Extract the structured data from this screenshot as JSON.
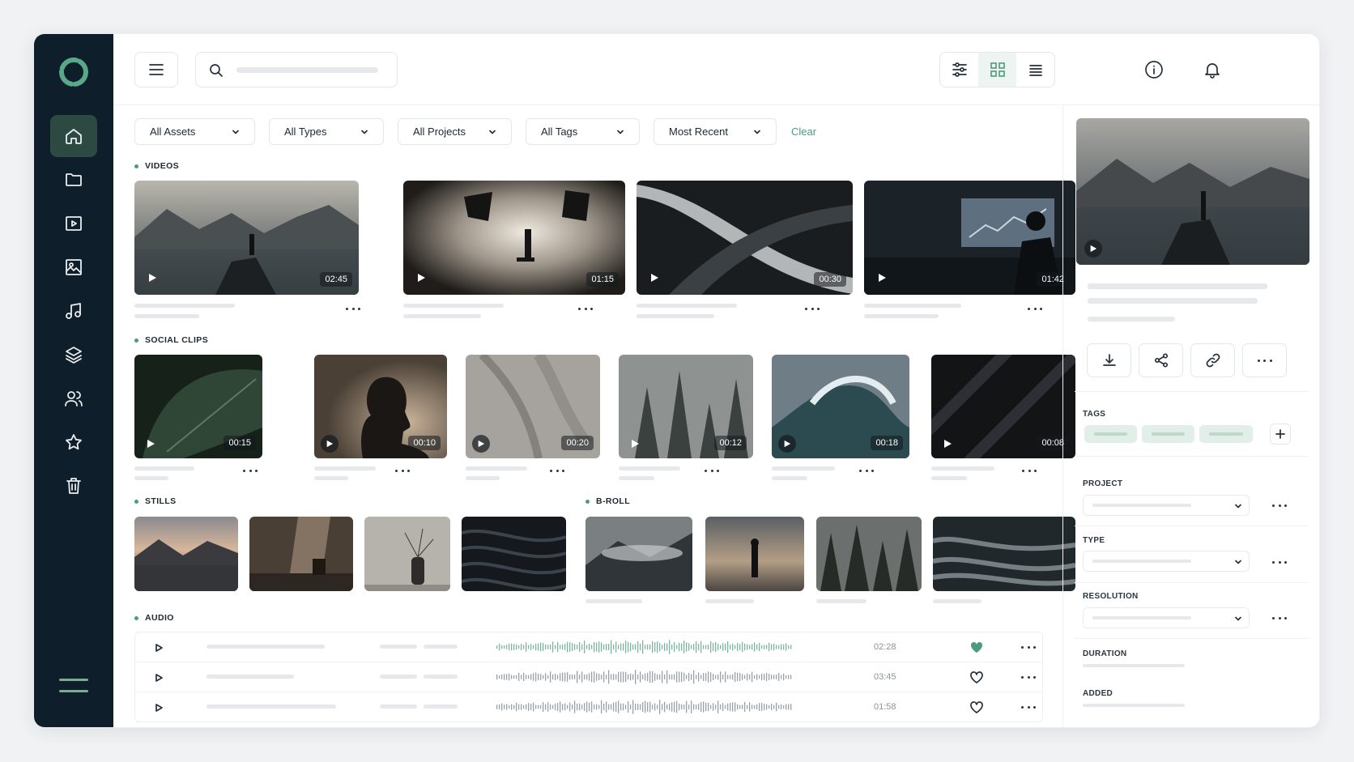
{
  "colors": {
    "sidebar": "#0f1e2b",
    "accent": "#4e9a7e",
    "active_nav": "#2c4a42"
  },
  "sidebar": {
    "items": [
      {
        "icon": "home-icon",
        "active": true
      },
      {
        "icon": "folder-icon"
      },
      {
        "icon": "video-icon"
      },
      {
        "icon": "image-icon"
      },
      {
        "icon": "music-icon"
      },
      {
        "icon": "layers-icon"
      },
      {
        "icon": "users-icon"
      },
      {
        "icon": "star-icon"
      },
      {
        "icon": "trash-icon"
      }
    ]
  },
  "topbar": {
    "view_modes": [
      "filter-settings-icon",
      "grid-icon",
      "list-icon"
    ],
    "active_view": "grid"
  },
  "filters": {
    "assets": "All Assets",
    "types": "All Types",
    "projects": "All Projects",
    "tags": "All Tags",
    "sort": "Most Recent",
    "clear": "Clear"
  },
  "sections": {
    "videos": "VIDEOS",
    "social": "SOCIAL CLIPS",
    "stills": "STILLS",
    "broll": "B-ROLL",
    "audio": "AUDIO"
  },
  "videos": [
    {
      "duration": "02:45"
    },
    {
      "duration": "01:15"
    },
    {
      "duration": "00:30"
    },
    {
      "duration": "01:42"
    }
  ],
  "social": [
    {
      "duration": "00:15"
    },
    {
      "duration": "00:10"
    },
    {
      "duration": "00:20"
    },
    {
      "duration": "00:12"
    },
    {
      "duration": "00:18"
    },
    {
      "duration": "00:08"
    }
  ],
  "audio": [
    {
      "duration": "02:28",
      "liked": true
    },
    {
      "duration": "03:45",
      "liked": false
    },
    {
      "duration": "01:58",
      "liked": false
    }
  ],
  "panel": {
    "tags": "TAGS",
    "project": "PROJECT",
    "type": "TYPE",
    "resolution": "RESOLUTION",
    "duration": "DURATION",
    "added": "ADDED"
  }
}
